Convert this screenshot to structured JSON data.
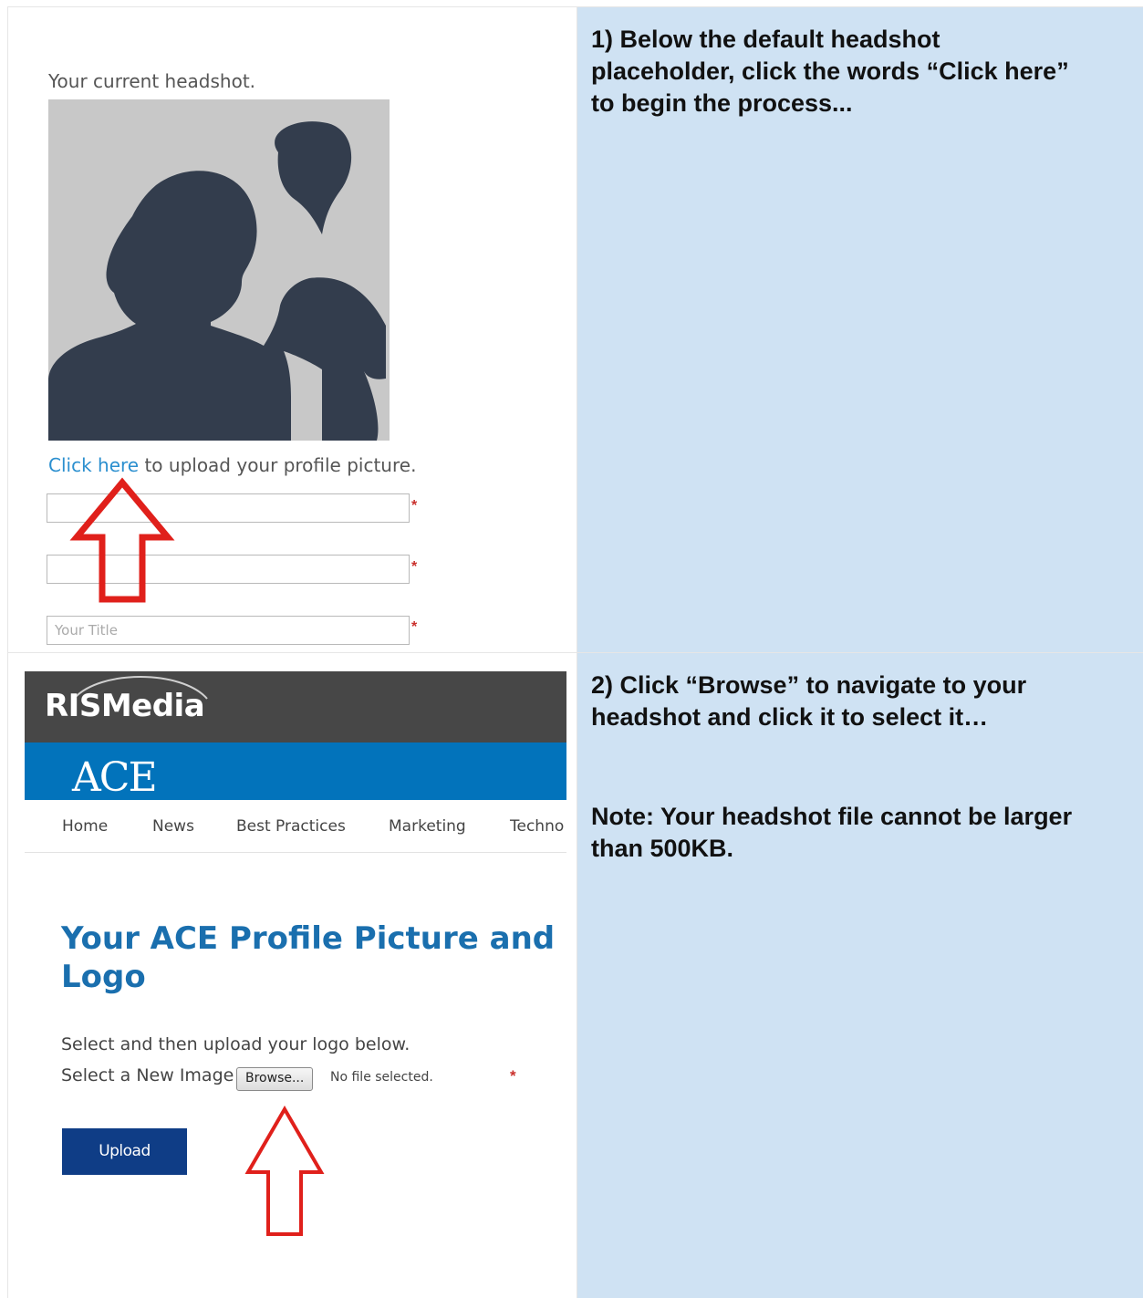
{
  "panel1": {
    "instruction": "1) Below the default headshot\nplaceholder, click the words “Click here”\nto begin the process...",
    "caption": "Your current headshot.",
    "headshot_icon": "people-silhouette-icon",
    "link_text": "Click here",
    "upload_text": " to upload your profile picture.",
    "field3_placeholder": "Your Title",
    "required_mark": "*",
    "arrow_color": "#e0201b"
  },
  "panel2": {
    "instruction": "2) Click “Browse” to navigate to  your\nheadshot and click it to select it…",
    "note": "Note: Your headshot file cannot be larger\nthan 500KB.",
    "brand": "RISMedia",
    "logo": "ACE",
    "nav": [
      "Home",
      "News",
      "Best Practices",
      "Marketing",
      "Techno"
    ],
    "title": "Your ACE Profile Picture and Logo",
    "intro": "Select and then upload your logo below.",
    "select_label": "Select a New Image",
    "browse_label": "Browse...",
    "file_status": "No file selected.",
    "required_mark": "*",
    "upload_label": "Upload",
    "arrow_color": "#e0201b"
  },
  "colors": {
    "instruction_bg": "#cfe2f3",
    "header_dark": "#474747",
    "brand_blue": "#0273bb",
    "title_blue": "#1a6fae",
    "button_navy": "#0f3d86",
    "link_blue": "#2b8fcf"
  }
}
